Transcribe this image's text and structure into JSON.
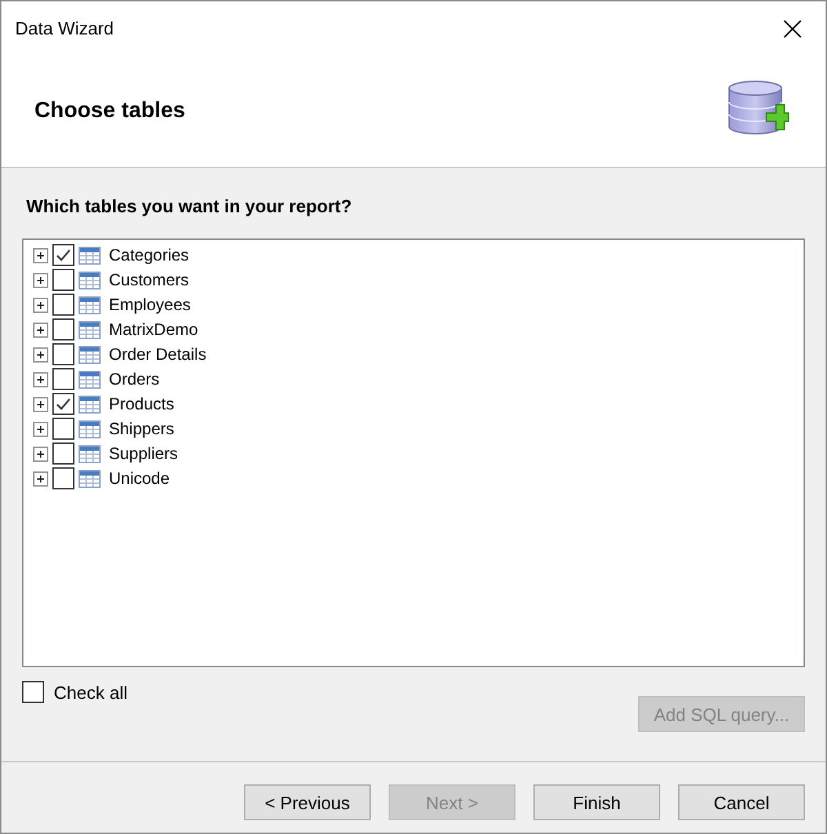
{
  "window": {
    "title": "Data Wizard"
  },
  "header": {
    "title": "Choose tables"
  },
  "question": "Which tables you want in your report?",
  "tables": [
    {
      "name": "Categories",
      "checked": true,
      "expanded": false
    },
    {
      "name": "Customers",
      "checked": false,
      "expanded": false
    },
    {
      "name": "Employees",
      "checked": false,
      "expanded": false
    },
    {
      "name": "MatrixDemo",
      "checked": false,
      "expanded": false
    },
    {
      "name": "Order Details",
      "checked": false,
      "expanded": false
    },
    {
      "name": "Orders",
      "checked": false,
      "expanded": false
    },
    {
      "name": "Products",
      "checked": true,
      "expanded": false
    },
    {
      "name": "Shippers",
      "checked": false,
      "expanded": false
    },
    {
      "name": "Suppliers",
      "checked": false,
      "expanded": false
    },
    {
      "name": "Unicode",
      "checked": false,
      "expanded": false
    }
  ],
  "check_all": {
    "label": "Check all",
    "checked": false
  },
  "add_sql": {
    "label": "Add SQL query...",
    "disabled": true
  },
  "buttons": [
    {
      "label": "< Previous",
      "disabled": false
    },
    {
      "label": "Next >",
      "disabled": true
    },
    {
      "label": "Finish",
      "disabled": false
    },
    {
      "label": "Cancel",
      "disabled": false
    }
  ]
}
